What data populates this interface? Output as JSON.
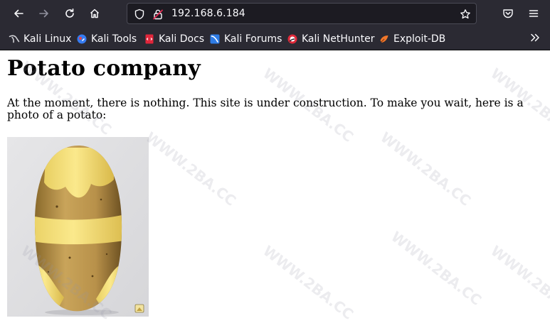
{
  "browser": {
    "url": "192.168.6.184",
    "bookmarks": [
      {
        "label": "Kali Linux",
        "icon": "kali-dragon-icon"
      },
      {
        "label": "Kali Tools",
        "icon": "kali-tools-icon"
      },
      {
        "label": "Kali Docs",
        "icon": "kali-docs-icon"
      },
      {
        "label": "Kali Forums",
        "icon": "kali-forums-icon"
      },
      {
        "label": "Kali NetHunter",
        "icon": "nethunter-icon"
      },
      {
        "label": "Exploit-DB",
        "icon": "exploit-db-icon"
      }
    ]
  },
  "page": {
    "title": "Potato company",
    "text": "At the moment, there is nothing. This site is under construction. To make you wait, here is a photo of a potato:"
  },
  "watermark": "WWW.2BA.CC",
  "colors": {
    "chrome_bg": "#2b2a33",
    "urlbar_bg": "#1c1b22",
    "chrome_text": "#fbfbfe",
    "page_bg": "#ffffff"
  }
}
